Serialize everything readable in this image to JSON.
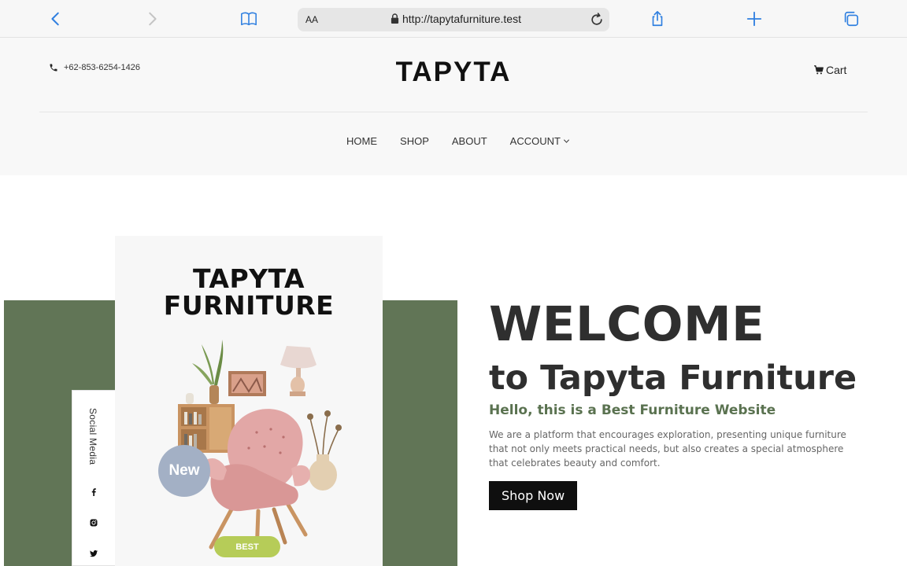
{
  "browser": {
    "aa_label": "AA",
    "url": "http://tapytafurniture.test"
  },
  "header": {
    "phone": "+62-853-6254-1426",
    "logo": "TAPYTA",
    "cart_label": "Cart"
  },
  "nav": {
    "items": [
      "HOME",
      "SHOP",
      "ABOUT",
      "ACCOUNT"
    ]
  },
  "poster": {
    "title_line1": "TAPYTA",
    "title_line2": "FURNITURE",
    "new_badge": "New",
    "best_badge": "BEST"
  },
  "social": {
    "label": "Social Media",
    "icons": [
      "facebook-icon",
      "instagram-icon",
      "twitter-icon"
    ]
  },
  "hero": {
    "welcome": "WELCOME",
    "subtitle": "to Tapyta Furniture",
    "tagline": "Hello, this is a Best Furniture Website",
    "description": "We are a platform that encourages exploration, presenting unique furniture that not only meets practical needs, but also creates a special atmosphere that celebrates beauty and comfort.",
    "cta": "Shop Now"
  },
  "colors": {
    "accent_green": "#617556",
    "tagline_green": "#5a7250",
    "badge_green": "#b6cc58",
    "badge_blue": "#a3b0c5",
    "ios_blue": "#2f7fe0"
  }
}
